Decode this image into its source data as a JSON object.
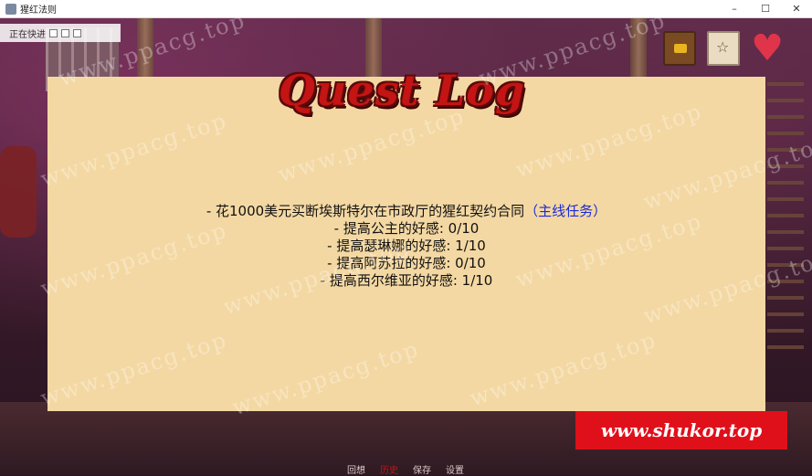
{
  "window": {
    "title": "猩红法则",
    "controls": {
      "minimize": "–",
      "maximize": "☐",
      "close": "✕"
    }
  },
  "skip_indicator": {
    "label": "正在快进"
  },
  "quest_log": {
    "title": "Quest Log",
    "quests": [
      {
        "text": "- 花1000美元买断埃斯特尔在市政厅的猩红契约合同",
        "tag": "（主线任务）"
      },
      {
        "text": "- 提高公主的好感: 0/10"
      },
      {
        "text": "- 提高瑟琳娜的好感: 1/10"
      },
      {
        "text": "- 提高阿苏拉的好感: 0/10"
      },
      {
        "text": "- 提高西尔维亚的好感: 1/10"
      }
    ]
  },
  "quick_menu": [
    "回想",
    "历史",
    "保存",
    "设置"
  ],
  "watermark": "www.ppacg.top",
  "stamp": "www.shukor.top",
  "hud_icons": [
    "quest-book-icon",
    "map-icon",
    "heart-icon"
  ]
}
